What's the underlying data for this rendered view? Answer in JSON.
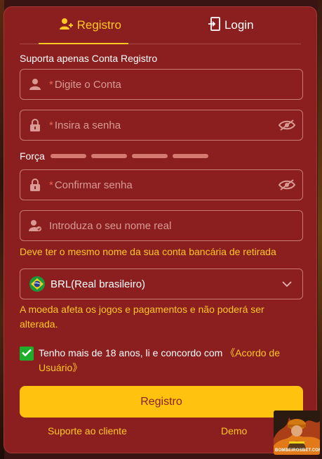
{
  "tabs": [
    {
      "label": "Registro",
      "icon": "add-user-icon",
      "active": true
    },
    {
      "label": "Login",
      "icon": "login-door-icon",
      "active": false
    }
  ],
  "form": {
    "support_note": "Suporta apenas Conta Registro",
    "required_mark": "*",
    "account_placeholder": "Digite o Conta",
    "password_placeholder": "Insira a senha",
    "strength_label": "Força",
    "confirm_placeholder": "Confirmar senha",
    "realname_placeholder": "Introduza o seu nome real",
    "realname_hint": "Deve ter o mesmo nome da sua conta bancária de retirada",
    "currency_value": "BRL(Real brasileiro)",
    "currency_hint": "A moeda afeta os jogos e pagamentos e não poderá ser alterada.",
    "agree_checked": true,
    "agree_text": "Tenho mais de 18 anos, li e concordo com",
    "agree_link": "《Acordo de Usuário》",
    "submit_label": "Registro"
  },
  "footer": {
    "support_link": "Suporte ao cliente",
    "demo_link": "Demo"
  },
  "badge": {
    "text": "BOMBEIROSBET.COM"
  },
  "colors": {
    "panel": "#8b1e1e",
    "accent": "#ffc824",
    "button": "#ffc20f",
    "input_border": "#c87b74",
    "placeholder": "#d99a94",
    "check": "#1fae2c"
  }
}
